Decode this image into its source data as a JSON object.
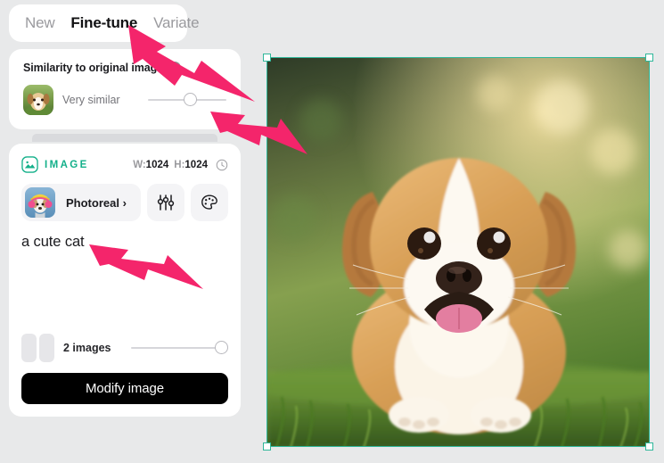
{
  "tabs": [
    {
      "label": "New",
      "active": false
    },
    {
      "label": "Fine-tune",
      "active": true
    },
    {
      "label": "Variate",
      "active": false
    }
  ],
  "similarity": {
    "title": "Similarity to original image",
    "help_icon": "question-mark-circle-icon",
    "thumbnail_alt": "original-puppy-thumbnail",
    "value_label": "Very similar",
    "slider_position_percent": 55
  },
  "image_panel": {
    "badge_icon": "image-icon",
    "badge_label": "IMAGE",
    "width_key": "W:",
    "width_value": "1024",
    "height_key": "H:",
    "height_value": "1024",
    "history_icon": "clock-icon",
    "model_name": "Photoreal",
    "model_chevron": "›",
    "model_thumbnail_alt": "photoreal-model-thumbnail",
    "settings_icon": "sliders-icon",
    "style_icon": "palette-icon",
    "prompt": "a cute cat"
  },
  "count": {
    "glyph": "two-images-icon",
    "label": "2 images",
    "slider_position_percent": 100
  },
  "submit": {
    "label": "Modify image"
  },
  "canvas": {
    "selection_color": "#2fb79a",
    "image_alt": "golden-and-white-puppy-sitting-on-grass",
    "handles": [
      "top-left",
      "top-right",
      "bottom-left",
      "bottom-right"
    ]
  },
  "annotations": {
    "color": "#f4256b",
    "arrows": [
      {
        "name": "arrow-pointing-to-variate-tab",
        "target": "Variate"
      },
      {
        "name": "arrow-pointing-to-similarity-slider",
        "target": "Very similar slider"
      },
      {
        "name": "arrow-pointing-to-prompt-text",
        "target": "a cute cat"
      }
    ]
  }
}
